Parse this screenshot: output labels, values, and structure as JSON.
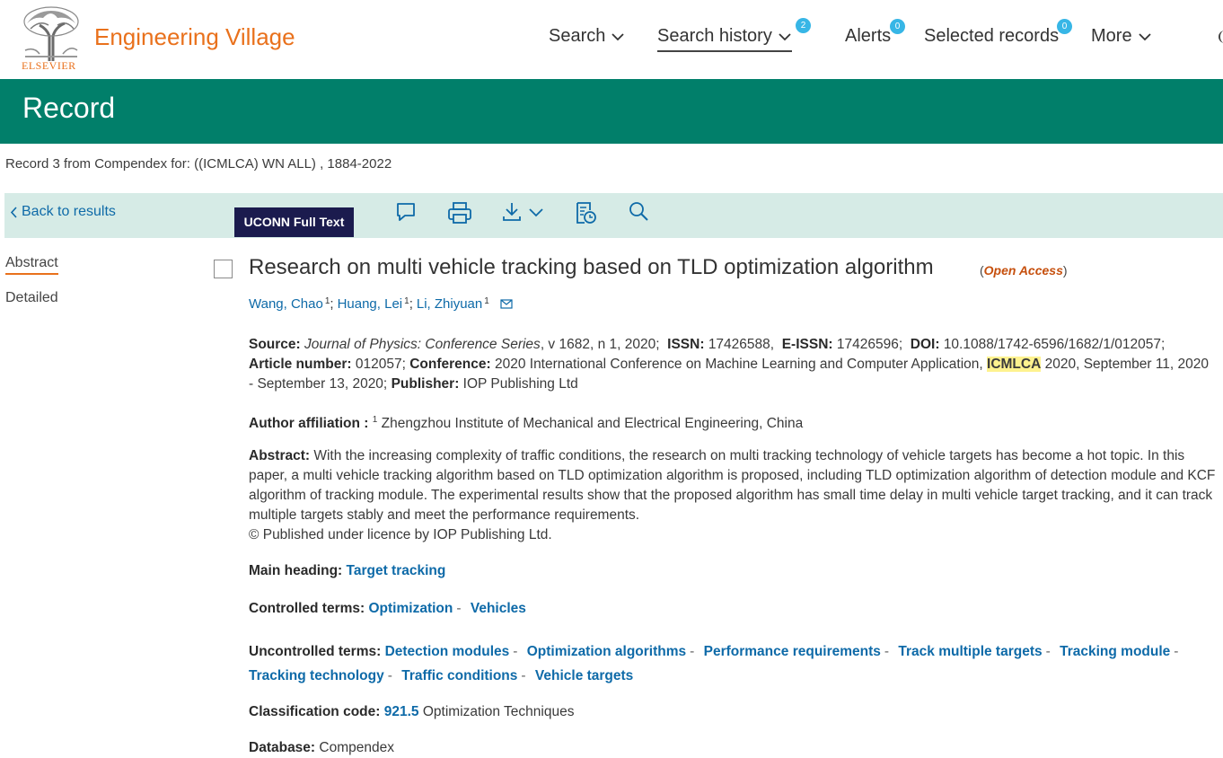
{
  "header": {
    "brand": "Engineering Village",
    "publisher": "ELSEVIER",
    "nav": {
      "search": "Search",
      "search_history": "Search history",
      "search_history_count": "2",
      "alerts": "Alerts",
      "alerts_count": "0",
      "selected_records": "Selected records",
      "selected_records_count": "0",
      "more": "More"
    }
  },
  "banner": {
    "title": "Record"
  },
  "record_info": "Record 3 from Compendex for: ((ICMLCA) WN ALL) , 1884-2022",
  "toolbar": {
    "back": "Back to results",
    "full_text": "UCONN Full Text",
    "icons": [
      "comment-icon",
      "print-icon",
      "download-icon",
      "history-icon",
      "search-icon"
    ]
  },
  "side_tabs": {
    "abstract": "Abstract",
    "detailed": "Detailed"
  },
  "record": {
    "title": "Research on multi vehicle tracking based on TLD optimization algorithm",
    "open_access": "Open Access",
    "authors": [
      {
        "name": "Wang, Chao",
        "sup": "1"
      },
      {
        "name": "Huang, Lei",
        "sup": "1"
      },
      {
        "name": "Li, Zhiyuan",
        "sup": "1"
      }
    ],
    "source": {
      "label": "Source:",
      "journal": "Journal of Physics: Conference Series",
      "volume": ", v 1682, n 1, 2020;",
      "issn_label": "ISSN:",
      "issn": "17426588,",
      "eissn_label": "E-ISSN:",
      "eissn": "17426596;",
      "doi_label": "DOI:",
      "doi": "10.1088/1742-6596/1682/1/012057;",
      "article_label": "Article number:",
      "article": "012057;",
      "conference_label": "Conference:",
      "conference_pre": "2020 International Conference on Machine Learning and Computer Application,",
      "conference_hl": "ICMLCA",
      "conference_post": "2020, September 11, 2020 - September 13, 2020;",
      "publisher_label": "Publisher:",
      "publisher": "IOP Publishing Ltd"
    },
    "affiliation": {
      "label": "Author affiliation :",
      "sup": "1",
      "text": "Zhengzhou Institute of Mechanical and Electrical Engineering, China"
    },
    "abstract": {
      "label": "Abstract:",
      "text": "With the increasing complexity of traffic conditions, the research on multi tracking technology of vehicle targets has become a hot topic. In this paper, a multi vehicle tracking algorithm based on TLD optimization algorithm is proposed, including TLD optimization algorithm of detection module and KCF algorithm of tracking module. The experimental results show that the proposed algorithm has small time delay in multi vehicle target tracking, and it can track multiple targets stably and meet the performance requirements.",
      "copyright": "© Published under licence by IOP Publishing Ltd."
    },
    "main_heading": {
      "label": "Main heading:",
      "value": "Target tracking"
    },
    "controlled_terms": {
      "label": "Controlled terms:",
      "items": [
        "Optimization",
        "Vehicles"
      ]
    },
    "uncontrolled_terms": {
      "label": "Uncontrolled terms:",
      "items": [
        "Detection modules",
        "Optimization algorithms",
        "Performance requirements",
        "Track multiple targets",
        "Tracking module",
        "Tracking technology",
        "Traffic conditions",
        "Vehicle targets"
      ]
    },
    "classification": {
      "label": "Classification code:",
      "code": "921.5",
      "text": "Optimization Techniques"
    },
    "database": {
      "label": "Database:",
      "value": "Compendex"
    }
  },
  "colors": {
    "brand_orange": "#e9711c",
    "banner_green": "#017f6a",
    "toolbar_bg": "#d6ebe6",
    "link_blue": "#0e6aa8",
    "badge_blue": "#37b6e6",
    "full_text_bg": "#1b1b4e",
    "highlight": "#fef28f"
  }
}
